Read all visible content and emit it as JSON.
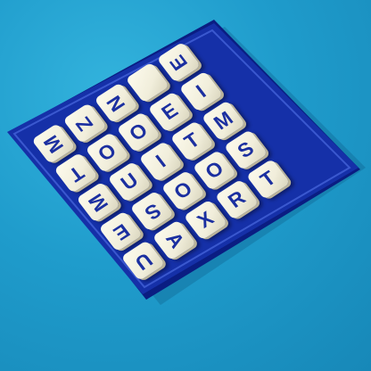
{
  "board": {
    "grid": [
      [
        {
          "letter": "M",
          "rot": 270
        },
        {
          "letter": "Z",
          "rot": 270
        },
        {
          "letter": "N",
          "rot": 270
        },
        {
          "letter": "",
          "rot": 0
        },
        {
          "letter": "E",
          "rot": 270
        }
      ],
      [
        {
          "letter": "T",
          "rot": 180
        },
        {
          "letter": "O",
          "rot": 0
        },
        {
          "letter": "O",
          "rot": 0
        },
        {
          "letter": "E",
          "rot": 0
        },
        {
          "letter": "I",
          "rot": 0
        }
      ],
      [
        {
          "letter": "M",
          "rot": 270
        },
        {
          "letter": "U",
          "rot": 0
        },
        {
          "letter": "I",
          "rot": 0
        },
        {
          "letter": "T",
          "rot": 0
        },
        {
          "letter": "M",
          "rot": 0
        }
      ],
      [
        {
          "letter": "E",
          "rot": 180
        },
        {
          "letter": "S",
          "rot": 180
        },
        {
          "letter": "O",
          "rot": 0
        },
        {
          "letter": "O",
          "rot": 0
        },
        {
          "letter": "S",
          "rot": 0
        }
      ],
      [
        {
          "letter": "U",
          "rot": 180
        },
        {
          "letter": "A",
          "rot": 90
        },
        {
          "letter": "X",
          "rot": 0
        },
        {
          "letter": "R",
          "rot": 0
        },
        {
          "letter": "T",
          "rot": 0
        }
      ]
    ]
  },
  "colors": {
    "table": "#1f9ccc",
    "tray": "#1530a8",
    "cube_face": "#f7f4e4",
    "letter_ink": "#1b2fa0"
  }
}
